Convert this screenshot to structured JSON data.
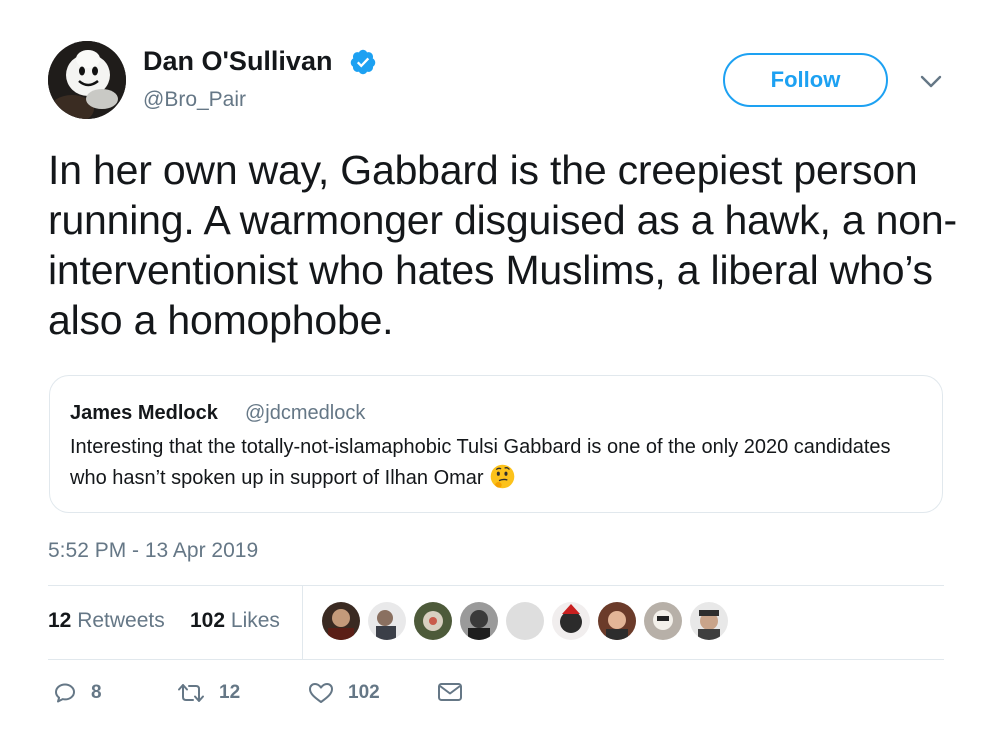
{
  "author": {
    "display_name": "Dan O'Sullivan",
    "handle": "@Bro_Pair",
    "verified": true
  },
  "follow_label": "Follow",
  "tweet_text": "In her own way, Gabbard is the creepiest person running. A warmonger disguised as a hawk, a non-interventionist who hates Muslims, a liberal who’s also a homophobe.",
  "quoted_tweet": {
    "display_name": "James Medlock",
    "handle": "@jdcmedlock",
    "text": "Interesting that the totally-not-islamaphobic Tulsi Gabbard is one of the only 2020 candidates who hasn’t spoken up in support of Ilhan Omar",
    "emoji": "thinking-face"
  },
  "timestamp": "5:52 PM - 13 Apr 2019",
  "stats": {
    "retweets_count": "12",
    "retweets_label": "Retweets",
    "likes_count": "102",
    "likes_label": "Likes"
  },
  "liker_avatars": [
    {
      "name": "liker-1",
      "color": "#3a2a22"
    },
    {
      "name": "liker-2",
      "color": "#5b5b60"
    },
    {
      "name": "liker-3",
      "color": "#4d5a3a"
    },
    {
      "name": "liker-4",
      "color": "#6e6e6e"
    },
    {
      "name": "liker-5",
      "color": "#d9d9d9"
    },
    {
      "name": "liker-6",
      "color": "#2b2b2b"
    },
    {
      "name": "liker-7",
      "color": "#6b3b2a"
    },
    {
      "name": "liker-8",
      "color": "#b7b0a8"
    },
    {
      "name": "liker-9",
      "color": "#3f3f3f"
    }
  ],
  "actions": {
    "reply_count": "8",
    "retweet_count": "12",
    "like_count": "102"
  },
  "colors": {
    "accent": "#1da1f2",
    "secondary_text": "#657786",
    "border": "#e1e8ed"
  },
  "icons": [
    "verified-icon",
    "chevron-down-icon",
    "reply-icon",
    "retweet-icon",
    "like-icon",
    "message-icon"
  ]
}
